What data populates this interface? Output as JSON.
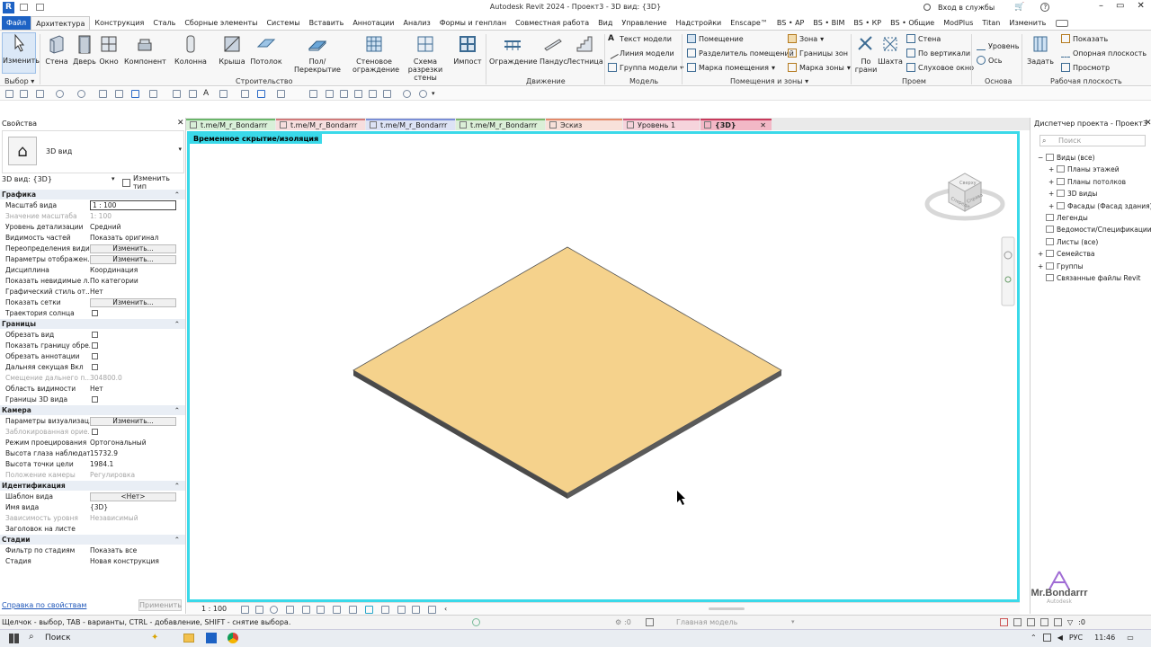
{
  "window": {
    "title": "Autodesk Revit 2024 - Проект3 - 3D вид: {3D}",
    "signin": "Вход в службы"
  },
  "menu": [
    "Файл",
    "Архитектура",
    "Конструкция",
    "Сталь",
    "Сборные элементы",
    "Системы",
    "Вставить",
    "Аннотации",
    "Анализ",
    "Формы и генплан",
    "Совместная работа",
    "Вид",
    "Управление",
    "Надстройки",
    "Enscape™",
    "BS • АР",
    "BS • BIM",
    "BS • КР",
    "BS • Общие",
    "ModPlus",
    "Titan",
    "Изменить"
  ],
  "ribbon": {
    "modify": "Изменить",
    "select": "Выбор",
    "build": [
      "Стена",
      "Дверь",
      "Окно",
      "Компонент",
      "Колонна",
      "Крыша",
      "Потолок",
      "Пол/Перекрытие"
    ],
    "curtain": [
      "Стеновое ограждение",
      "Схема разрезки стены",
      "Импост"
    ],
    "circulation": [
      "Ограждение",
      "Пандус",
      "Лестница"
    ],
    "model": [
      "Текст модели",
      "Линия модели",
      "Группа модели"
    ],
    "room": [
      "Помещение",
      "Разделитель помещений",
      "Марка помещения"
    ],
    "area": [
      "Зона",
      "Границы зон",
      "Марка зоны"
    ],
    "opening": [
      "По грани",
      "Шахта",
      "Стена",
      "По вертикали",
      "Слуховое окно"
    ],
    "datum": [
      "Уровень",
      "Ось"
    ],
    "workplane_set": "Задать",
    "workplane": [
      "Показать",
      "Опорная плоскость",
      "Просмотр"
    ],
    "panels": [
      "Строительство",
      "Движение",
      "Модель",
      "Помещения и зоны",
      "Проем",
      "Основа",
      "Рабочая плоскость"
    ]
  },
  "properties": {
    "header": "Свойства",
    "type_name": "3D вид",
    "instance": "3D вид: {3D}",
    "edit_type": "Изменить тип",
    "sections": [
      {
        "title": "Графика",
        "rows": [
          {
            "k": "Масштаб вида",
            "v": "1 : 100"
          },
          {
            "k": "Значение масштаба",
            "v": "1:    100",
            "dim": true
          },
          {
            "k": "Уровень детализации",
            "v": "Средний"
          },
          {
            "k": "Видимость частей",
            "v": "Показать оригинал"
          },
          {
            "k": "Переопределения види...",
            "v": "Изменить...",
            "btn": true
          },
          {
            "k": "Параметры отображен...",
            "v": "Изменить...",
            "btn": true
          },
          {
            "k": "Дисциплина",
            "v": "Координация"
          },
          {
            "k": "Показать невидимые л...",
            "v": "По категории"
          },
          {
            "k": "Графический стиль от...",
            "v": "Нет"
          },
          {
            "k": "Показать сетки",
            "v": "Изменить...",
            "btn": true
          },
          {
            "k": "Траектория солнца",
            "v": "",
            "chk": true
          }
        ]
      },
      {
        "title": "Границы",
        "rows": [
          {
            "k": "Обрезать вид",
            "v": "",
            "chk": true
          },
          {
            "k": "Показать границу обре...",
            "v": "",
            "chk": true
          },
          {
            "k": "Обрезать аннотации",
            "v": "",
            "chk": true
          },
          {
            "k": "Дальняя секущая Вкл",
            "v": "",
            "chk": true
          },
          {
            "k": "Смещение дальнего п...",
            "v": "304800.0",
            "dim": true
          },
          {
            "k": "Область видимости",
            "v": "Нет"
          },
          {
            "k": "Границы 3D вида",
            "v": "",
            "chk": true
          }
        ]
      },
      {
        "title": "Камера",
        "rows": [
          {
            "k": "Параметры визуализац...",
            "v": "Изменить...",
            "btn": true
          },
          {
            "k": "Заблокированная орие...",
            "v": "",
            "chk": true,
            "dim": true
          },
          {
            "k": "Режим проецирования",
            "v": "Ортогональный"
          },
          {
            "k": "Высота глаза наблюдат...",
            "v": "15732.9"
          },
          {
            "k": "Высота точки цели",
            "v": "1984.1"
          },
          {
            "k": "Положение камеры",
            "v": "Регулировка",
            "dim": true
          }
        ]
      },
      {
        "title": "Идентификация",
        "rows": [
          {
            "k": "Шаблон вида",
            "v": "<Нет>",
            "btn": true
          },
          {
            "k": "Имя вида",
            "v": "{3D}"
          },
          {
            "k": "Зависимость уровня",
            "v": "Независимый",
            "dim": true
          },
          {
            "k": "Заголовок на листе",
            "v": ""
          }
        ]
      },
      {
        "title": "Стадии",
        "rows": [
          {
            "k": "Фильтр по стадиям",
            "v": "Показать все"
          },
          {
            "k": "Стадия",
            "v": "Новая конструкция"
          }
        ]
      }
    ],
    "help_link": "Справка по свойствам",
    "apply": "Применить"
  },
  "tabs": [
    {
      "label": "t.me/M_r_Bondarrr",
      "color": "#d9f0d9",
      "bar": "#6ab56a"
    },
    {
      "label": "t.me/M_r_Bondarrr",
      "color": "#f6dede",
      "bar": "#d07a7a"
    },
    {
      "label": "t.me/M_r_Bondarrr",
      "color": "#dde3f5",
      "bar": "#7a8ed6"
    },
    {
      "label": "t.me/M_r_Bondarrr",
      "color": "#dbefd8",
      "bar": "#7ab56a"
    },
    {
      "label": "Эскиз",
      "color": "#f8e1da",
      "bar": "#e38a6a"
    },
    {
      "label": "Уровень 1",
      "color": "#f6d4dc",
      "bar": "#d05a7a"
    },
    {
      "label": "{3D}",
      "color": "#f2b8c6",
      "bar": "#c83a5c"
    }
  ],
  "viewport": {
    "banner": "Временное скрытие/изоляция",
    "scale": "1 : 100",
    "slab_color": "#f5d28c",
    "accent": "#3ad9e9"
  },
  "browser": {
    "header": "Диспетчер проекта - Проект3",
    "search_placeholder": "Поиск",
    "items": [
      "Виды (все)",
      "Планы этажей",
      "Планы потолков",
      "3D виды",
      "Фасады (Фасад здания)",
      "Легенды",
      "Ведомости/Спецификации (все)",
      "Листы (все)",
      "Семейства",
      "Группы",
      "Связанные файлы Revit"
    ]
  },
  "watermark": {
    "name": "Mr.Bondarrr",
    "sub": "Autodesk"
  },
  "status": {
    "hint": "Щелчок - выбор, TAB - варианты, CTRL - добавление, SHIFT - снятие выбора.",
    "zero1": ":0",
    "model": "Главная модель",
    "zero2": ":0"
  },
  "taskbar": {
    "search": "Поиск",
    "lang": "РУС",
    "time": "11:46"
  },
  "viewcube": [
    "Сверху",
    "Спереди",
    "Справа"
  ]
}
